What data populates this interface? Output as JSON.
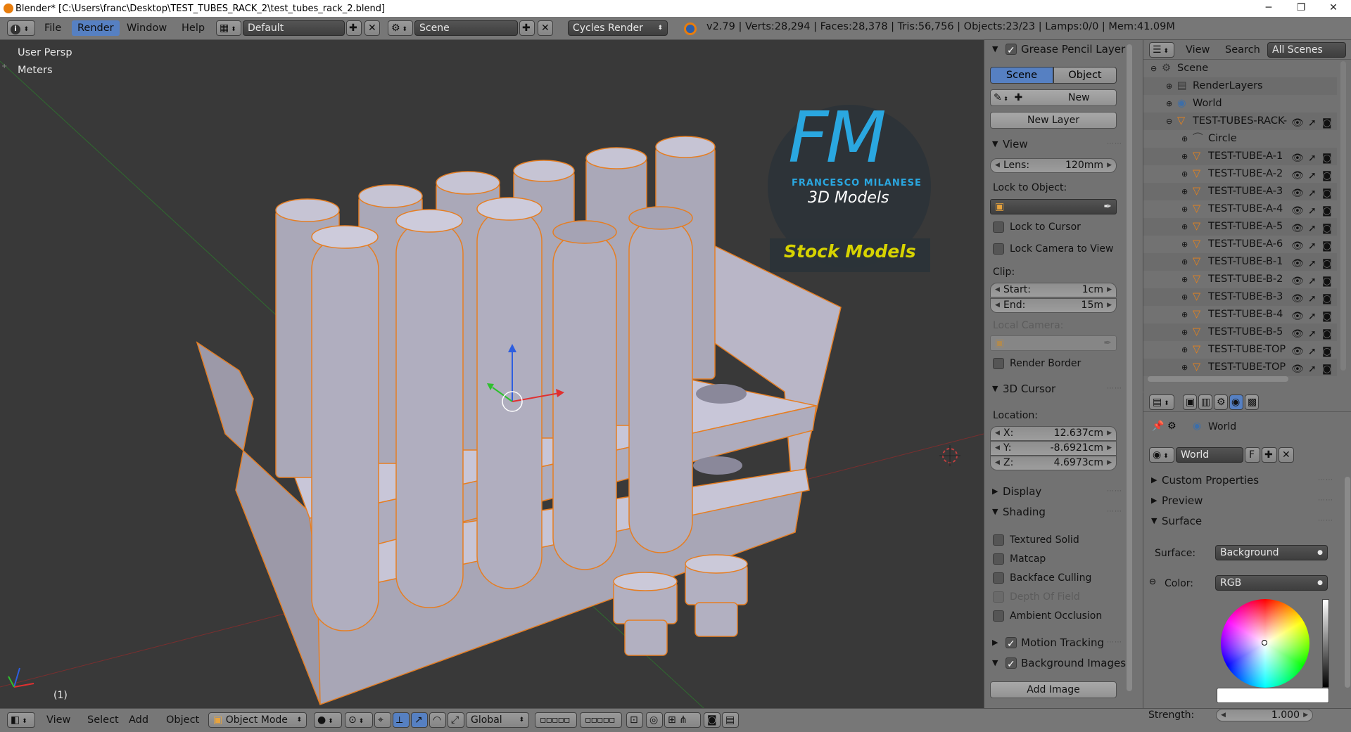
{
  "window": {
    "title": "Blender* [C:\\Users\\franc\\Desktop\\TEST_TUBES_RACK_2\\test_tubes_rack_2.blend]",
    "minimize": "─",
    "maximize": "❐",
    "close": "✕"
  },
  "info_header": {
    "menus": [
      "File",
      "Render",
      "Window",
      "Help"
    ],
    "active_menu": "Render",
    "screen_layout": "Default",
    "scene": "Scene",
    "render_engine": "Cycles Render",
    "stats": "v2.79 | Verts:28,294 | Faces:28,378 | Tris:56,756 | Objects:23/23 | Lamps:0/0 | Mem:41.09M"
  },
  "viewport": {
    "view_name": "User Persp",
    "units": "Meters",
    "frame": "(1)",
    "watermark": {
      "logo": "FM",
      "company": "FRANCESCO MILANESE",
      "tagline": "3D Models",
      "badge": "Stock Models"
    }
  },
  "properties_panel": {
    "grease_pencil": {
      "title": "Grease Pencil Layer",
      "tabs": [
        "Scene",
        "Object"
      ],
      "active_tab": "Scene",
      "new_button": "New",
      "new_layer_button": "New Layer"
    },
    "view": {
      "title": "View",
      "lens_label": "Lens:",
      "lens_value": "120mm",
      "lock_to_object": "Lock to Object:",
      "lock_to_cursor": "Lock to Cursor",
      "lock_camera": "Lock Camera to View",
      "clip": "Clip:",
      "start_label": "Start:",
      "start_value": "1cm",
      "end_label": "End:",
      "end_value": "15m",
      "local_camera": "Local Camera:",
      "render_border": "Render Border"
    },
    "cursor": {
      "title": "3D Cursor",
      "location": "Location:",
      "x_label": "X:",
      "x_value": "12.637cm",
      "y_label": "Y:",
      "y_value": "-8.6921cm",
      "z_label": "Z:",
      "z_value": "4.6973cm"
    },
    "display": {
      "title": "Display"
    },
    "shading": {
      "title": "Shading",
      "options": [
        "Textured Solid",
        "Matcap",
        "Backface Culling",
        "Depth Of Field",
        "Ambient Occlusion"
      ]
    },
    "motion_tracking": {
      "title": "Motion Tracking"
    },
    "background_images": {
      "title": "Background Images",
      "add_image": "Add Image"
    }
  },
  "outliner": {
    "menus": [
      "View",
      "Search"
    ],
    "filter": "All Scenes",
    "items": [
      {
        "label": "Scene",
        "indent": 0,
        "icon": "scene-icon"
      },
      {
        "label": "RenderLayers",
        "indent": 1,
        "icon": "renderlayers-icon"
      },
      {
        "label": "World",
        "indent": 1,
        "icon": "world-icon"
      },
      {
        "label": "TEST-TUBES-RACK-",
        "indent": 1,
        "icon": "mesh-icon"
      },
      {
        "label": "Circle",
        "indent": 2,
        "icon": "curve-icon"
      },
      {
        "label": "TEST-TUBE-A-1",
        "indent": 2,
        "icon": "mesh-icon"
      },
      {
        "label": "TEST-TUBE-A-2",
        "indent": 2,
        "icon": "mesh-icon"
      },
      {
        "label": "TEST-TUBE-A-3",
        "indent": 2,
        "icon": "mesh-icon"
      },
      {
        "label": "TEST-TUBE-A-4",
        "indent": 2,
        "icon": "mesh-icon"
      },
      {
        "label": "TEST-TUBE-A-5",
        "indent": 2,
        "icon": "mesh-icon"
      },
      {
        "label": "TEST-TUBE-A-6",
        "indent": 2,
        "icon": "mesh-icon"
      },
      {
        "label": "TEST-TUBE-B-1",
        "indent": 2,
        "icon": "mesh-icon"
      },
      {
        "label": "TEST-TUBE-B-2",
        "indent": 2,
        "icon": "mesh-icon"
      },
      {
        "label": "TEST-TUBE-B-3",
        "indent": 2,
        "icon": "mesh-icon"
      },
      {
        "label": "TEST-TUBE-B-4",
        "indent": 2,
        "icon": "mesh-icon"
      },
      {
        "label": "TEST-TUBE-B-5",
        "indent": 2,
        "icon": "mesh-icon"
      },
      {
        "label": "TEST-TUBE-TOP",
        "indent": 2,
        "icon": "mesh-icon"
      },
      {
        "label": "TEST-TUBE-TOP",
        "indent": 2,
        "icon": "mesh-icon"
      }
    ]
  },
  "world_props": {
    "breadcrumb": "World",
    "datablock": "World",
    "fake_user": "F",
    "panels": [
      "Custom Properties",
      "Preview",
      "Surface"
    ],
    "surface_label": "Surface:",
    "surface_value": "Background",
    "color_label": "Color:",
    "color_mode": "RGB",
    "strength_label": "Strength:",
    "strength_value": "1.000"
  },
  "bottom_header": {
    "menus": [
      "View",
      "Select",
      "Add",
      "Object"
    ],
    "mode": "Object Mode",
    "orientation": "Global"
  },
  "colors": {
    "accent": "#5680c2",
    "viewport_bg": "#393939",
    "panel_bg": "#727272",
    "selection_outline": "#e67e22",
    "fm_blue": "#2aa7e0",
    "stock_yellow": "#d7d300"
  }
}
